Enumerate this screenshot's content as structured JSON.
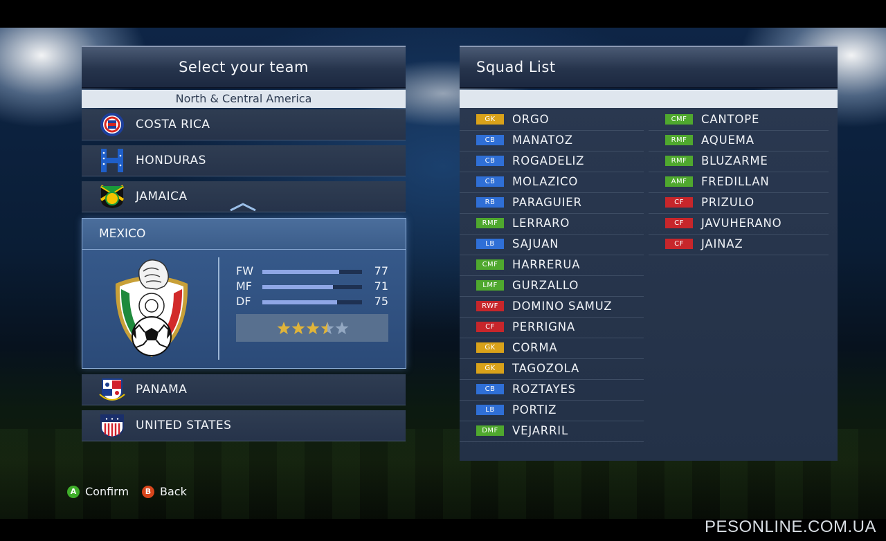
{
  "left_panel": {
    "title": "Select your team",
    "region": "North & Central America",
    "teams_above": [
      {
        "name": "COSTA RICA",
        "flag": "costa-rica-crest"
      },
      {
        "name": "HONDURAS",
        "flag": "honduras-crest"
      },
      {
        "name": "JAMAICA",
        "flag": "jamaica-crest"
      }
    ],
    "selected": {
      "name": "MEXICO",
      "crest": "mexico-crest",
      "stats": [
        {
          "label": "FW",
          "value": 77
        },
        {
          "label": "MF",
          "value": 71
        },
        {
          "label": "DF",
          "value": 75
        }
      ],
      "stars": 3.5,
      "stars_max": 5
    },
    "teams_below": [
      {
        "name": "PANAMA",
        "flag": "panama-crest"
      },
      {
        "name": "UNITED STATES",
        "flag": "usa-crest"
      }
    ]
  },
  "right_panel": {
    "title": "Squad List",
    "column1": [
      {
        "pos": "GK",
        "name": "ORGO"
      },
      {
        "pos": "CB",
        "name": "MANATOZ"
      },
      {
        "pos": "CB",
        "name": "ROGADELIZ"
      },
      {
        "pos": "CB",
        "name": "MOLAZICO"
      },
      {
        "pos": "RB",
        "name": "PARAGUIER"
      },
      {
        "pos": "RMF",
        "name": "LERRARO"
      },
      {
        "pos": "LB",
        "name": "SAJUAN"
      },
      {
        "pos": "CMF",
        "name": "HARRERUA"
      },
      {
        "pos": "LMF",
        "name": "GURZALLO"
      },
      {
        "pos": "RWF",
        "name": "DOMINO SAMUZ"
      },
      {
        "pos": "CF",
        "name": "PERRIGNA"
      },
      {
        "pos": "GK",
        "name": "CORMA"
      },
      {
        "pos": "GK",
        "name": "TAGOZOLA"
      },
      {
        "pos": "CB",
        "name": "ROZTAYES"
      },
      {
        "pos": "LB",
        "name": "PORTIZ"
      },
      {
        "pos": "DMF",
        "name": "VEJARRIL"
      }
    ],
    "column2": [
      {
        "pos": "CMF",
        "name": "CANTOPE"
      },
      {
        "pos": "RMF",
        "name": "AQUEMA"
      },
      {
        "pos": "RMF",
        "name": "BLUZARME"
      },
      {
        "pos": "AMF",
        "name": "FREDILLAN"
      },
      {
        "pos": "CF",
        "name": "PRIZULO"
      },
      {
        "pos": "CF",
        "name": "JAVUHERANO"
      },
      {
        "pos": "CF",
        "name": "JAINAZ"
      }
    ]
  },
  "position_colors": {
    "GK": "#d9a21a",
    "CB": "#2f6fd6",
    "RB": "#2f6fd6",
    "LB": "#2f6fd6",
    "CMF": "#4fa82e",
    "RMF": "#4fa82e",
    "LMF": "#4fa82e",
    "AMF": "#4fa82e",
    "DMF": "#4fa82e",
    "CF": "#c7262b",
    "RWF": "#c7262b"
  },
  "footer": {
    "confirm": {
      "key": "A",
      "label": "Confirm",
      "color": "#3fae2a"
    },
    "back": {
      "key": "B",
      "label": "Back",
      "color": "#d8461c"
    }
  },
  "watermark": "PESONLINE.COM.UA"
}
